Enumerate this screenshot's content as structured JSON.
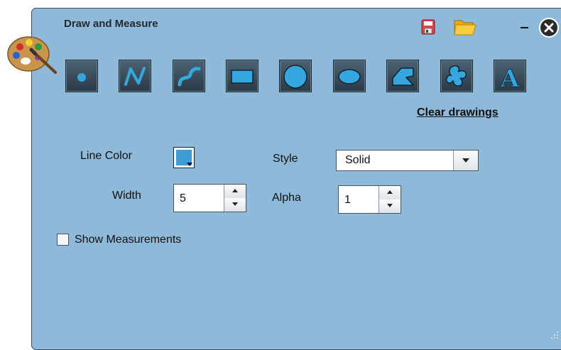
{
  "window": {
    "title": "Draw and Measure"
  },
  "header_icons": [
    "palette-icon",
    "save-icon",
    "folder-icon",
    "minimize-icon",
    "close-icon"
  ],
  "tools": [
    {
      "name": "point-tool",
      "icon": "point-icon"
    },
    {
      "name": "polyline-tool",
      "icon": "polyline-icon"
    },
    {
      "name": "freehand-line-tool",
      "icon": "freehand-line-icon"
    },
    {
      "name": "rectangle-tool",
      "icon": "rectangle-icon"
    },
    {
      "name": "circle-tool",
      "icon": "circle-icon"
    },
    {
      "name": "ellipse-tool",
      "icon": "ellipse-icon"
    },
    {
      "name": "polygon-tool",
      "icon": "polygon-icon"
    },
    {
      "name": "freehand-polygon-tool",
      "icon": "freehand-polygon-icon"
    },
    {
      "name": "text-tool",
      "icon": "text-icon"
    }
  ],
  "clear_link": "Clear drawings",
  "form": {
    "line_color_label": "Line Color",
    "line_color_value": "#3e9bd6",
    "width_label": "Width",
    "width_value": "5",
    "style_label": "Style",
    "style_value": "Solid",
    "alpha_label": "Alpha",
    "alpha_value": "1",
    "show_measurements_label": "Show Measurements",
    "show_measurements_checked": false
  },
  "colors": {
    "panel_bg": "#8fb9d8",
    "tool_bg": "#3a4d5b",
    "tool_glyph": "#36a6df"
  }
}
